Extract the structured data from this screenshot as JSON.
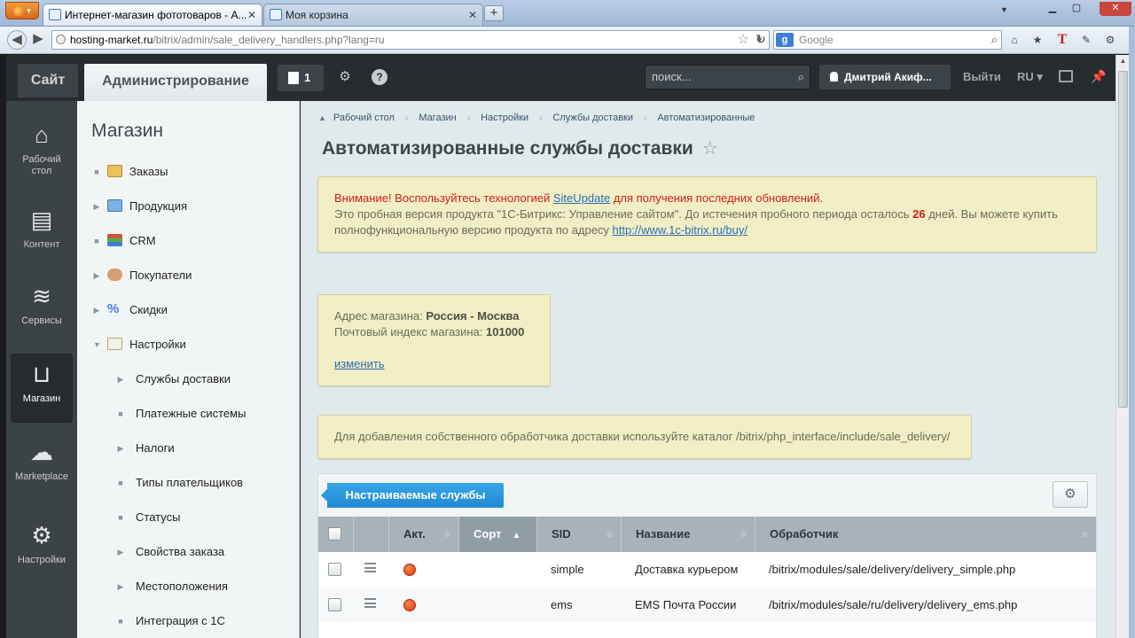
{
  "browser": {
    "tabs": [
      {
        "label": "Интернет-магазин фототоваров - А...",
        "active": true
      },
      {
        "label": "Моя корзина",
        "active": false
      }
    ],
    "firefox_label": "▾",
    "url_domain": "hosting-market.ru",
    "url_path": "/bitrix/admin/sale_delivery_handlers.php?lang=ru",
    "search_placeholder": "Google"
  },
  "topbar": {
    "site_label": "Сайт",
    "admin_label": "Администрирование",
    "notifications_count": "1",
    "search_placeholder": "поиск...",
    "user_name": "Дмитрий Акиф...",
    "logout_label": "Выйти",
    "lang_label": "RU ▾"
  },
  "leftnav": {
    "items": [
      {
        "label": "Рабочий стол",
        "icon": "home-icon"
      },
      {
        "label": "Контент",
        "icon": "document-icon"
      },
      {
        "label": "Сервисы",
        "icon": "layers-icon"
      },
      {
        "label": "Магазин",
        "icon": "basket-icon",
        "active": true
      },
      {
        "label": "Marketplace",
        "icon": "cloud-icon"
      },
      {
        "label": "Настройки",
        "icon": "gear-icon"
      }
    ]
  },
  "submenu": {
    "title": "Магазин",
    "items": [
      {
        "label": "Заказы"
      },
      {
        "label": "Продукция"
      },
      {
        "label": "CRM"
      },
      {
        "label": "Покупатели"
      },
      {
        "label": "Скидки"
      },
      {
        "label": "Настройки"
      },
      {
        "label": "Службы доставки"
      },
      {
        "label": "Платежные системы"
      },
      {
        "label": "Налоги"
      },
      {
        "label": "Типы плательщиков"
      },
      {
        "label": "Статусы"
      },
      {
        "label": "Свойства заказа"
      },
      {
        "label": "Местоположения"
      },
      {
        "label": "Интеграция с 1С"
      }
    ]
  },
  "breadcrumbs": [
    "Рабочий стол",
    "Магазин",
    "Настройки",
    "Службы доставки",
    "Автоматизированные"
  ],
  "page_title": "Автоматизированные службы доставки",
  "warning": {
    "line1_a": "Внимание! Воспользуйтесь технологией ",
    "line1_link": "SiteUpdate",
    "line1_b": " для получения последних обновлений.",
    "line2_a": "Это пробная версия продукта \"1С-Битрикс: Управление сайтом\". До истечения пробного периода осталось ",
    "line2_days": "26",
    "line2_b": " дней. Вы можете купить",
    "line3_a": "полнофункциональную версию продукта по адресу ",
    "line3_link": "http://www.1c-bitrix.ru/buy/"
  },
  "store": {
    "address_label": "Адрес магазина: ",
    "address_value": "Россия - Москва",
    "zip_label": "Почтовый индекс магазина: ",
    "zip_value": "101000",
    "change_link": "изменить"
  },
  "info_note": "Для добавления собственного обработчика доставки используйте каталог /bitrix/php_interface/include/sale_delivery/",
  "grid": {
    "tab_label": "Настраиваемые службы",
    "columns": [
      "Акт.",
      "Сорт",
      "SID",
      "Название",
      "Обработчик"
    ],
    "rows": [
      {
        "sid": "simple",
        "name": "Доставка курьером",
        "handler": "/bitrix/modules/sale/delivery/delivery_simple.php"
      },
      {
        "sid": "ems",
        "name": "EMS Почта России",
        "handler": "/bitrix/modules/sale/ru/delivery/delivery_ems.php"
      }
    ]
  }
}
